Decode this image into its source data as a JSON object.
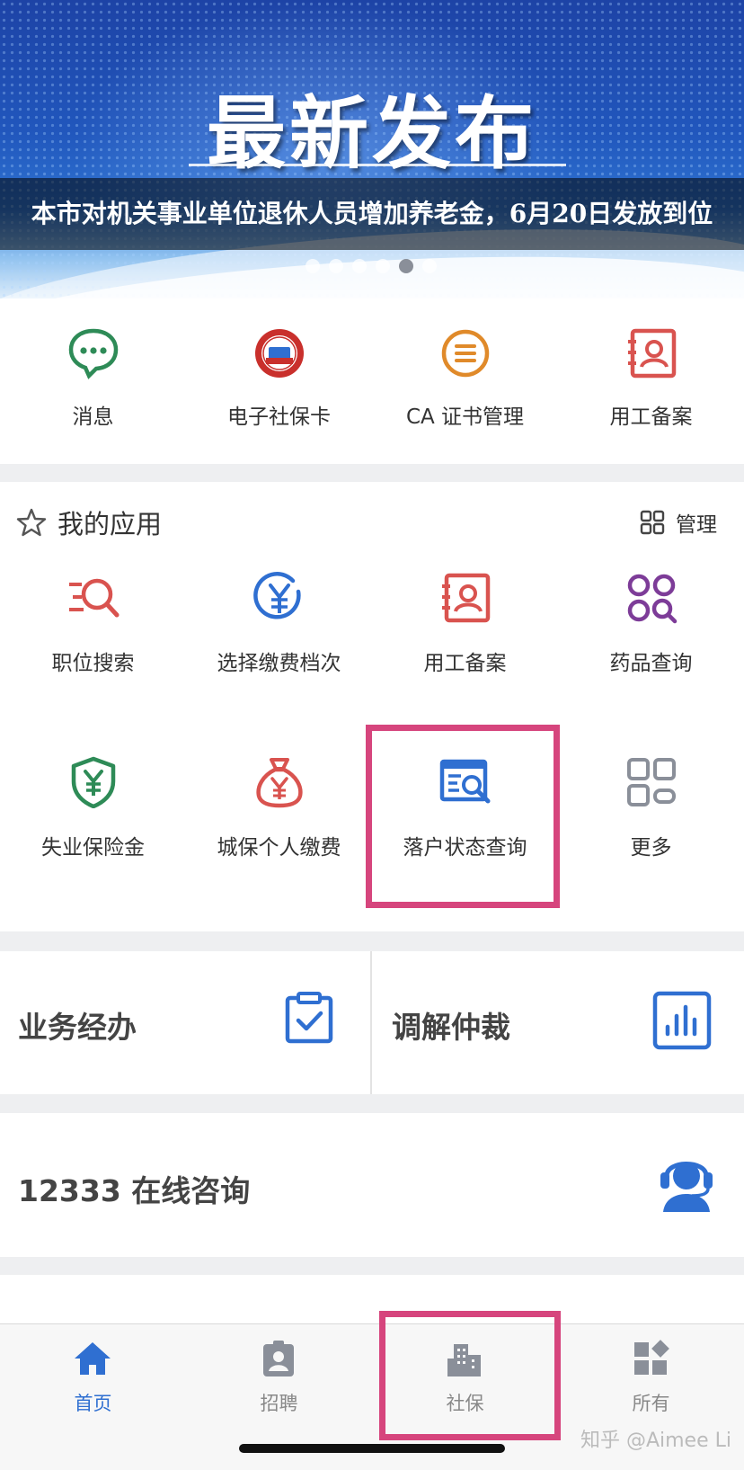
{
  "banner": {
    "headline": "最新发布",
    "caption": "本市对机关事业单位退休人员增加养老金，6月20日发放到位",
    "pager_count": 6,
    "pager_active": 5
  },
  "quick_actions": [
    {
      "label": "消息",
      "icon": "chat-bubble-icon"
    },
    {
      "label": "电子社保卡",
      "icon": "social-security-card-seal-icon"
    },
    {
      "label": "CA 证书管理",
      "icon": "certificate-list-icon"
    },
    {
      "label": "用工备案",
      "icon": "employee-record-icon"
    }
  ],
  "my_apps": {
    "title": "我的应用",
    "manage_label": "管理",
    "items": [
      {
        "label": "职位搜索",
        "icon": "job-search-icon"
      },
      {
        "label": "选择缴费档次",
        "icon": "yuan-coin-icon"
      },
      {
        "label": "用工备案",
        "icon": "employee-record-icon"
      },
      {
        "label": "药品查询",
        "icon": "medicine-query-icon"
      },
      {
        "label": "失业保险金",
        "icon": "yuan-shield-icon"
      },
      {
        "label": "城保个人缴费",
        "icon": "money-bag-icon"
      },
      {
        "label": "落户状态查询",
        "icon": "status-query-icon"
      },
      {
        "label": "更多",
        "icon": "more-grid-icon"
      }
    ]
  },
  "business": {
    "left_title": "业务经办",
    "right_title": "调解仲裁"
  },
  "consult": {
    "title": "12333 在线咨询"
  },
  "tabs": [
    {
      "label": "首页",
      "icon": "home-icon",
      "active": true
    },
    {
      "label": "招聘",
      "icon": "badge-icon",
      "active": false
    },
    {
      "label": "社保",
      "icon": "building-icon",
      "active": false
    },
    {
      "label": "所有",
      "icon": "apps-icon",
      "active": false
    }
  ],
  "watermark": "知乎 @Aimee Li",
  "colors": {
    "accent_blue": "#2f6fd1",
    "green": "#2e8b57",
    "red": "#d9534f",
    "orange": "#e08a2a",
    "purple": "#7d3c98",
    "highlight": "#d6457d"
  }
}
